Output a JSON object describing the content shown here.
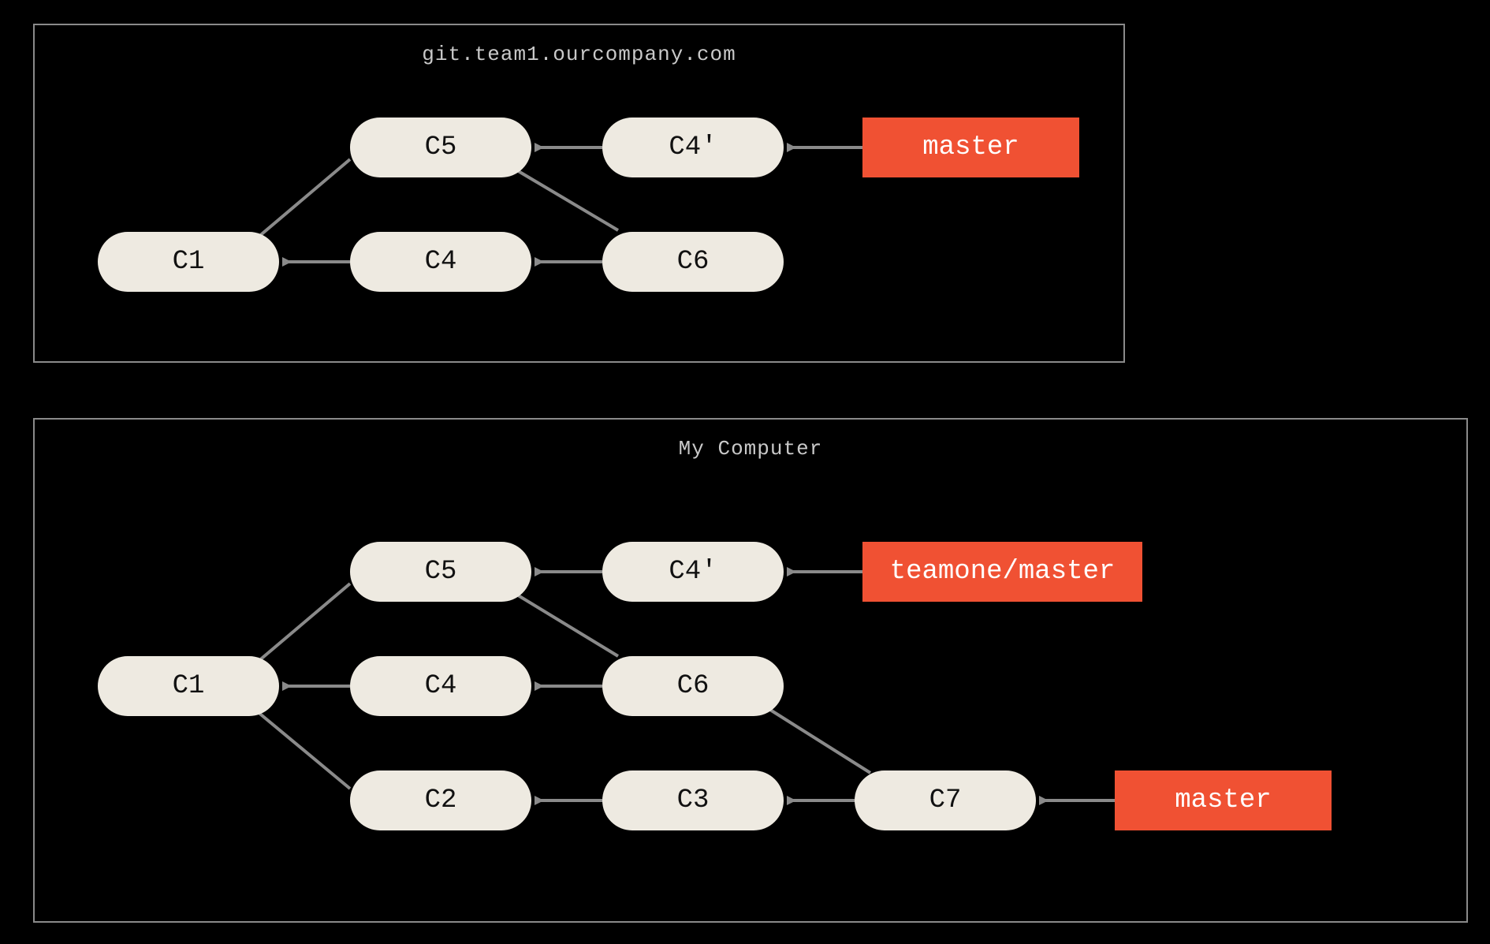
{
  "colors": {
    "background": "#000000",
    "panel_border": "#8a8a8a",
    "commit_fill": "#eeeae1",
    "commit_text": "#111111",
    "ref_fill": "#f05133",
    "ref_text": "#ffffff",
    "edge": "#8a8a8a",
    "title_text": "#c9c9c9"
  },
  "panels": {
    "remote": {
      "title": "git.team1.ourcompany.com",
      "commits": {
        "c1": "C1",
        "c4": "C4",
        "c5": "C5",
        "c6": "C6",
        "c4p": "C4'"
      },
      "refs": {
        "master": "master"
      },
      "edges": [
        {
          "from": "C5",
          "to": "C1"
        },
        {
          "from": "C4",
          "to": "C1"
        },
        {
          "from": "C4'",
          "to": "C5"
        },
        {
          "from": "C6",
          "to": "C4"
        },
        {
          "from": "C6",
          "to": "C5"
        },
        {
          "from_ref": "master",
          "to": "C4'"
        }
      ]
    },
    "local": {
      "title": "My Computer",
      "commits": {
        "c1": "C1",
        "c2": "C2",
        "c3": "C3",
        "c4": "C4",
        "c5": "C5",
        "c6": "C6",
        "c7": "C7",
        "c4p": "C4'"
      },
      "refs": {
        "teamone_master": "teamone/master",
        "master": "master"
      },
      "edges": [
        {
          "from": "C5",
          "to": "C1"
        },
        {
          "from": "C4",
          "to": "C1"
        },
        {
          "from": "C2",
          "to": "C1"
        },
        {
          "from": "C4'",
          "to": "C5"
        },
        {
          "from": "C6",
          "to": "C4"
        },
        {
          "from": "C6",
          "to": "C5"
        },
        {
          "from": "C3",
          "to": "C2"
        },
        {
          "from": "C7",
          "to": "C3"
        },
        {
          "from": "C7",
          "to": "C6"
        },
        {
          "from_ref": "teamone/master",
          "to": "C4'"
        },
        {
          "from_ref": "master",
          "to": "C7"
        }
      ]
    }
  }
}
